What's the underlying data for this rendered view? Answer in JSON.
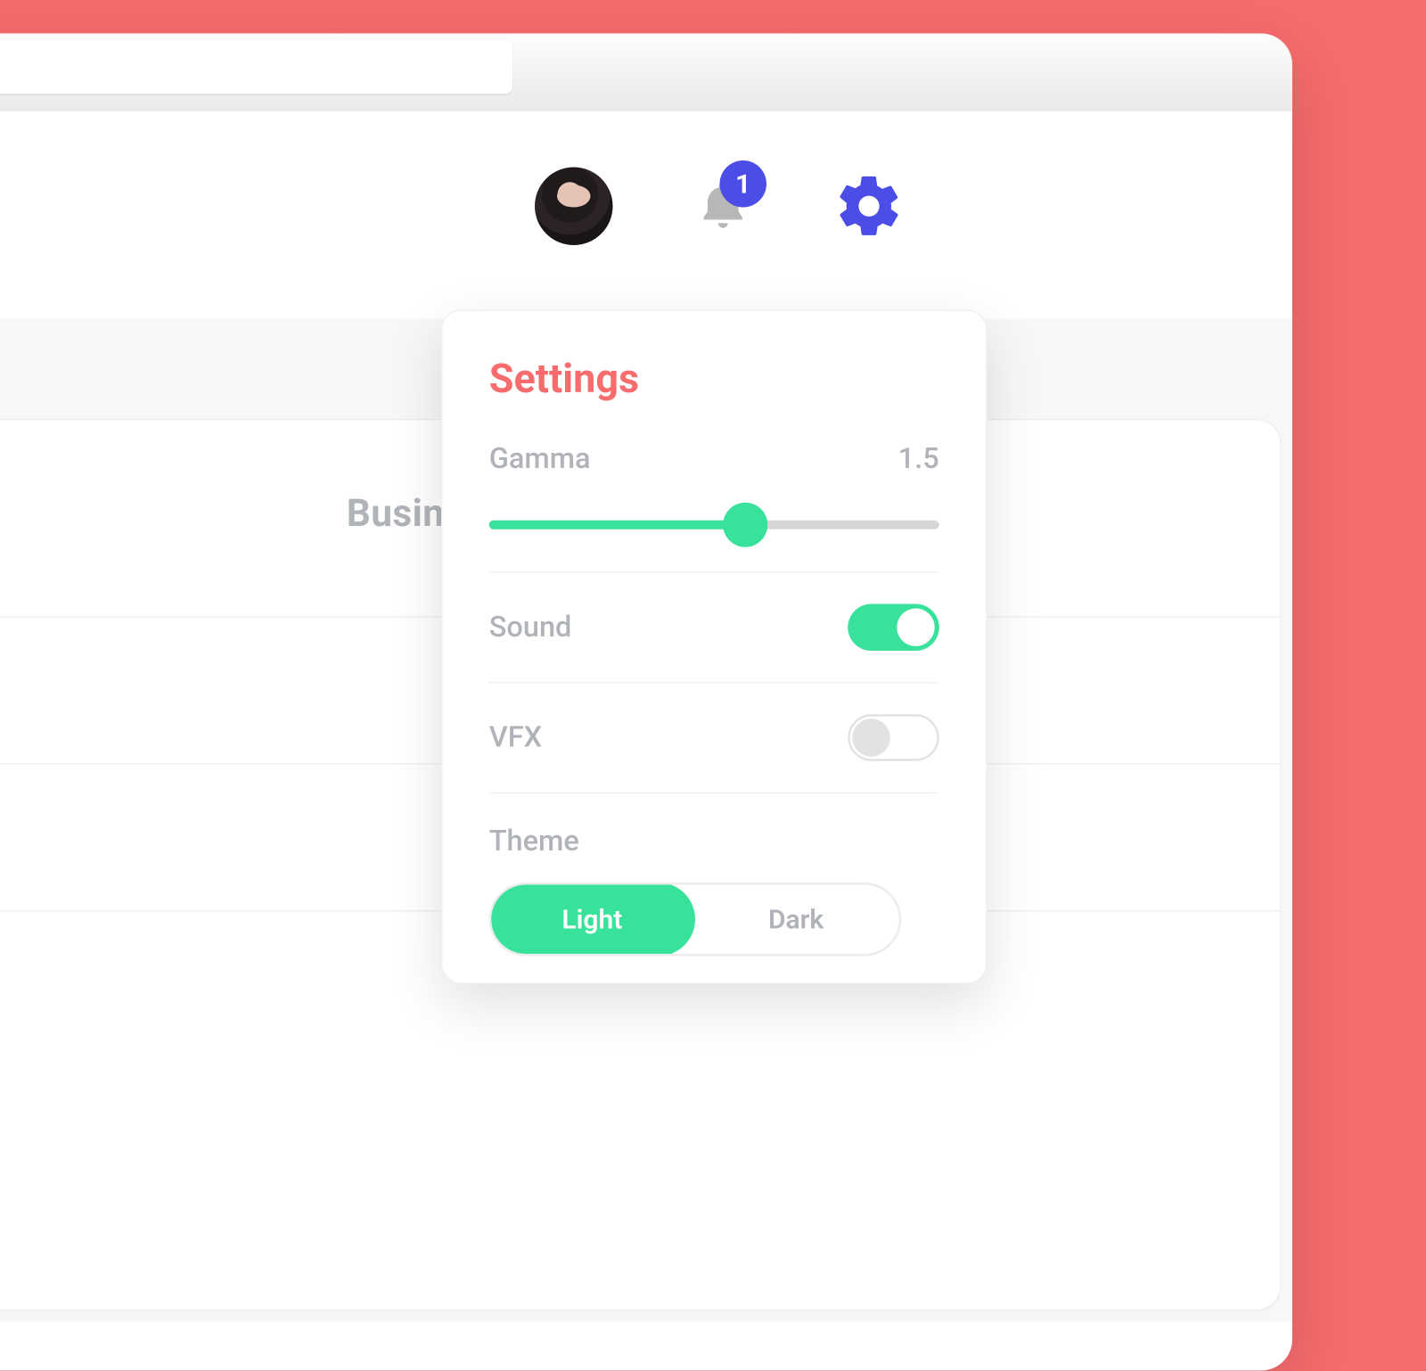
{
  "colors": {
    "accent_blue": "#4C4CE6",
    "accent_green": "#38E29B",
    "accent_coral": "#F76C6C",
    "muted_text": "#B0B3B8"
  },
  "topbar": {
    "notification_count": "1"
  },
  "card": {
    "title_partial": "Busin"
  },
  "settings_panel": {
    "title": "Settings",
    "gamma": {
      "label": "Gamma",
      "value": "1.5",
      "fill_percent": 57
    },
    "sound": {
      "label": "Sound",
      "on": true
    },
    "vfx": {
      "label": "VFX",
      "on": false
    },
    "theme": {
      "label": "Theme",
      "options": [
        "Light",
        "Dark"
      ],
      "selected": "Light"
    }
  }
}
